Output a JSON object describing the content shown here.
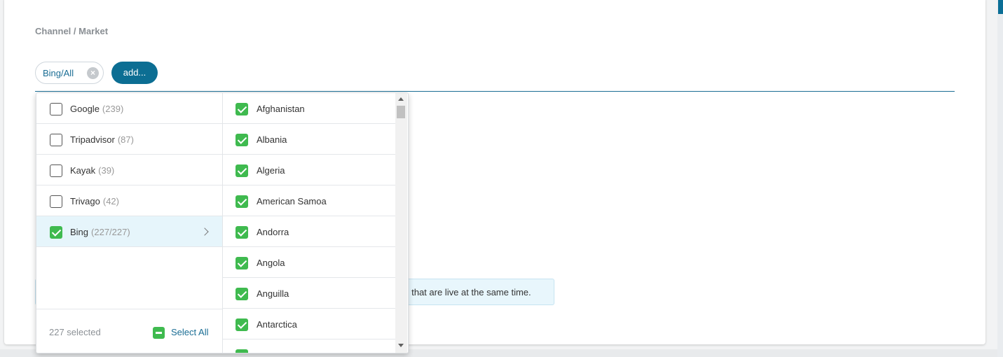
{
  "section": {
    "label": "Channel / Market"
  },
  "chips": [
    {
      "label": "Bing/All"
    }
  ],
  "add_button": {
    "label": "add..."
  },
  "info": {
    "text": "s that are live at the same time."
  },
  "channels": [
    {
      "name": "Google",
      "count": "(239)",
      "checked": false
    },
    {
      "name": "Tripadvisor",
      "count": "(87)",
      "checked": false
    },
    {
      "name": "Kayak",
      "count": "(39)",
      "checked": false
    },
    {
      "name": "Trivago",
      "count": "(42)",
      "checked": false
    },
    {
      "name": "Bing",
      "count": "(227/227)",
      "checked": true
    }
  ],
  "markets": [
    {
      "name": "Afghanistan",
      "checked": true
    },
    {
      "name": "Albania",
      "checked": true
    },
    {
      "name": "Algeria",
      "checked": true
    },
    {
      "name": "American Samoa",
      "checked": true
    },
    {
      "name": "Andorra",
      "checked": true
    },
    {
      "name": "Angola",
      "checked": true
    },
    {
      "name": "Anguilla",
      "checked": true
    },
    {
      "name": "Antarctica",
      "checked": true
    }
  ],
  "footer": {
    "selected_text": "227 selected",
    "select_all_label": "Select All"
  },
  "colors": {
    "accent": "#0c6e93",
    "check": "#3fba4f",
    "active_row": "#e6f5fb"
  }
}
